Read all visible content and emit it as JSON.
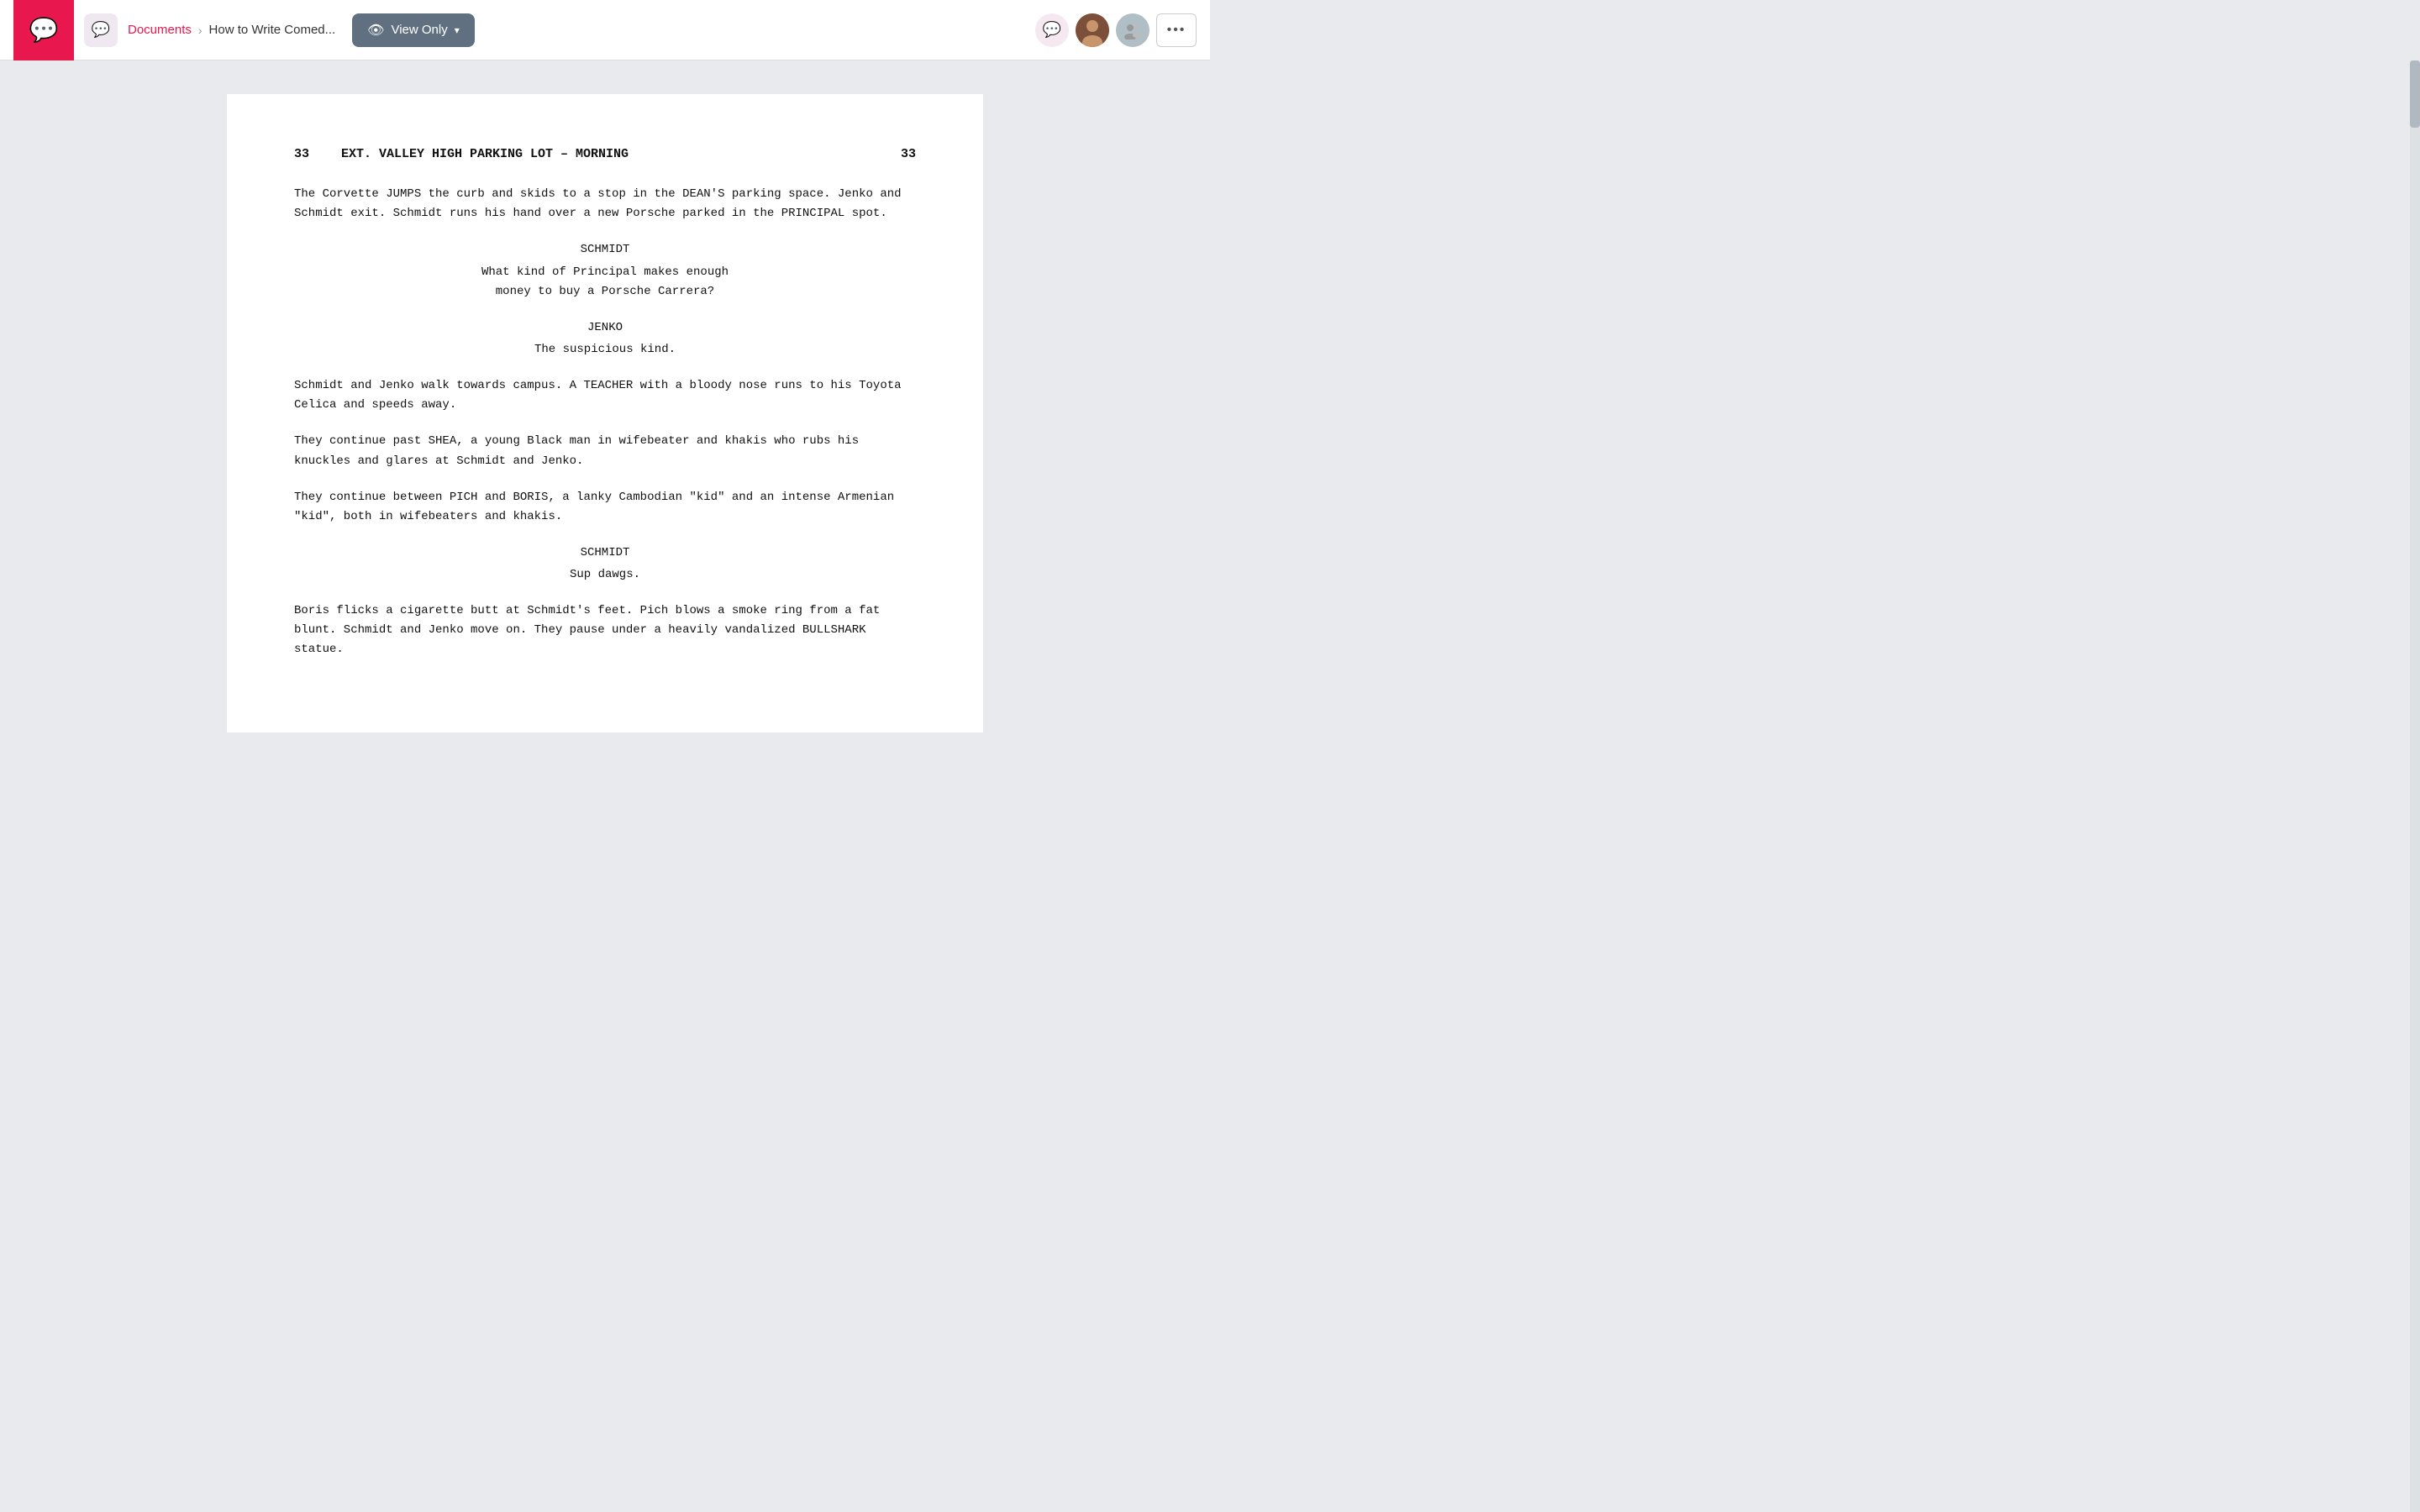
{
  "navbar": {
    "logo_icon": "💬",
    "app_icon": "💬",
    "breadcrumb": {
      "link_label": "Documents",
      "separator": "›",
      "current": "How to Write Comed..."
    },
    "view_only_label": "View Only",
    "eye_icon": "👁",
    "chevron_icon": "▾",
    "more_dots": "•••"
  },
  "script": {
    "scene_number_left": "33",
    "scene_title": "EXT. VALLEY HIGH PARKING LOT – MORNING",
    "scene_number_right": "33",
    "blocks": [
      {
        "type": "action",
        "text": "The Corvette JUMPS the curb and skids to a stop in the DEAN'S parking space. Jenko and Schmidt exit. Schmidt runs his hand over a new Porsche parked in the PRINCIPAL spot."
      },
      {
        "type": "dialogue",
        "character": "SCHMIDT",
        "lines": "What kind of Principal makes enough\nmoney to buy a Porsche Carrera?"
      },
      {
        "type": "dialogue",
        "character": "JENKO",
        "lines": "The suspicious kind."
      },
      {
        "type": "action",
        "text": "Schmidt and Jenko walk towards campus. A TEACHER with a bloody nose runs to his Toyota Celica and speeds away."
      },
      {
        "type": "action",
        "text": "They continue past SHEA, a young Black man in wifebeater and khakis who rubs his knuckles and glares at Schmidt and Jenko."
      },
      {
        "type": "action",
        "text": "They continue between PICH and BORIS, a lanky Cambodian \"kid\" and an intense Armenian \"kid\", both in wifebeaters and khakis."
      },
      {
        "type": "dialogue",
        "character": "SCHMIDT",
        "lines": "Sup dawgs."
      },
      {
        "type": "action",
        "text": "Boris flicks a cigarette butt at Schmidt's feet. Pich blows a smoke ring from a fat blunt. Schmidt and Jenko move on. They pause under a heavily vandalized BULLSHARK statue."
      }
    ]
  }
}
